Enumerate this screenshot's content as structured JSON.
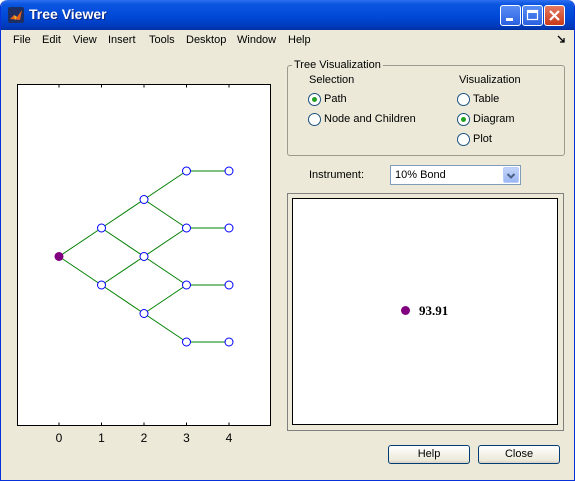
{
  "window": {
    "title": "Tree Viewer"
  },
  "menu": [
    "File",
    "Edit",
    "View",
    "Insert",
    "Tools",
    "Desktop",
    "Window",
    "Help"
  ],
  "tree_plot": {
    "x_ticks": [
      "0",
      "1",
      "2",
      "3",
      "4"
    ],
    "line_color": "#008000",
    "node_color": "#0000ff",
    "selected_color": "#800080",
    "levels": [
      [
        0
      ],
      [
        1,
        -1
      ],
      [
        2,
        0,
        -2
      ],
      [
        3,
        1,
        -1,
        -3
      ],
      [
        3,
        1,
        -1,
        -3
      ]
    ]
  },
  "visualization_group": {
    "title": "Tree Visualization",
    "selection_label": "Selection",
    "visualization_label": "Visualization",
    "selection_options": [
      "Path",
      "Node and Children"
    ],
    "selection_selected": 0,
    "visualization_options": [
      "Table",
      "Diagram",
      "Plot"
    ],
    "visualization_selected": 1
  },
  "instrument": {
    "label": "Instrument:",
    "value": "10% Bond"
  },
  "node_value": {
    "value": "93.91",
    "color": "#800080"
  },
  "buttons": {
    "help": "Help",
    "close": "Close"
  }
}
